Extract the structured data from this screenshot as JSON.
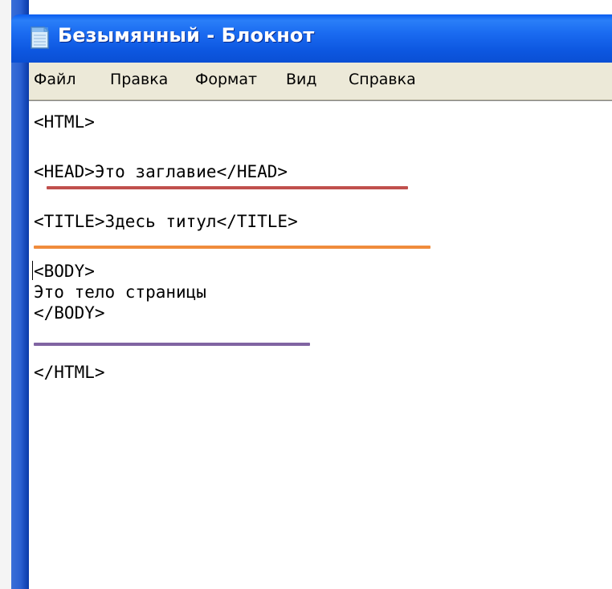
{
  "window": {
    "title": "Безымянный - Блокнот",
    "icon": "notepad-icon"
  },
  "menu": {
    "items": [
      "Файл",
      "Правка",
      "Формат",
      "Вид",
      "Справка"
    ]
  },
  "editor": {
    "lines": [
      "<HTML>",
      "<HEAD>Это заглавие</HEAD>",
      "<TITLE>Здесь титул</TITLE>",
      "<BODY>",
      "Это тело страницы",
      "</BODY>",
      "</HTML>"
    ]
  },
  "annotations": {
    "head_underline_color": "#c0504d",
    "title_underline_color": "#f08c3c",
    "body_underline_color": "#8064a2"
  },
  "colors": {
    "titlebar": "#0d57e0",
    "menubar": "#ece9d8"
  }
}
